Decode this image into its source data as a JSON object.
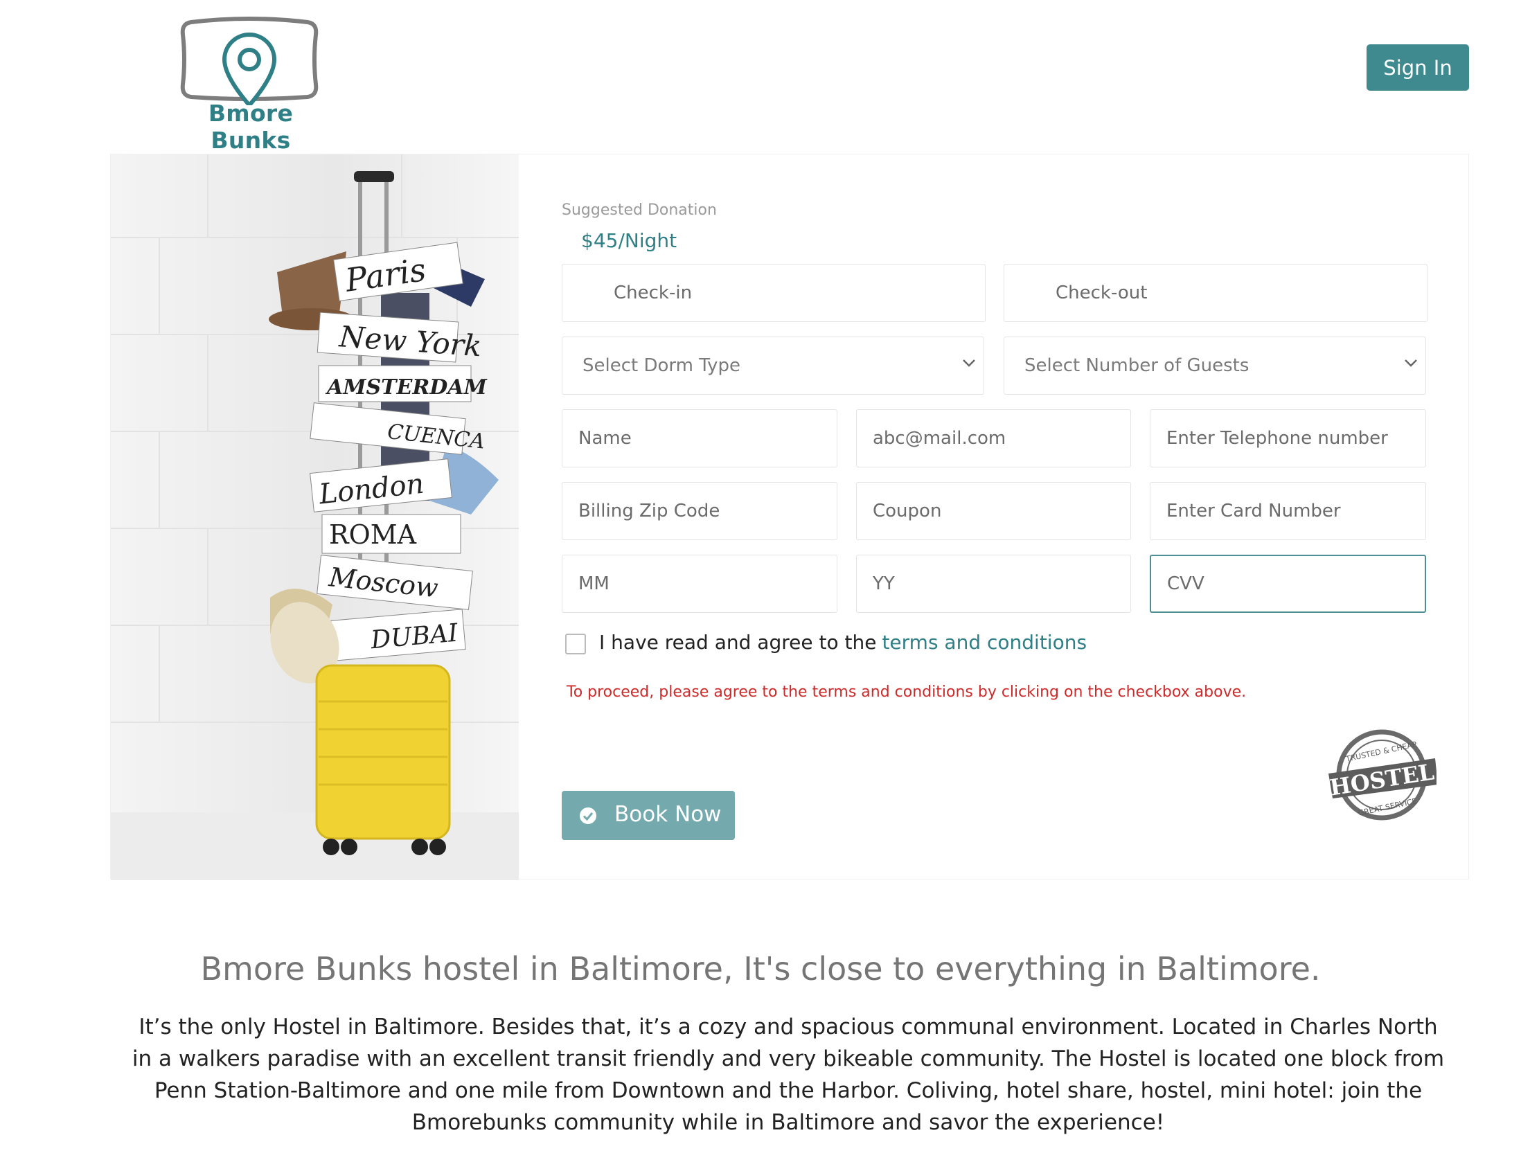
{
  "header": {
    "logo_text": "Bmore Bunks",
    "signin_label": "Sign In"
  },
  "booking": {
    "donation_label": "Suggested Donation",
    "donation_value": "$45/Night",
    "checkin_placeholder": "Check-in",
    "checkout_placeholder": "Check-out",
    "dorm_placeholder": "Select Dorm Type",
    "guests_placeholder": "Select Number of Guests",
    "name_placeholder": "Name",
    "email_placeholder": "abc@mail.com",
    "phone_placeholder": "Enter Telephone number",
    "zip_placeholder": "Billing Zip Code",
    "coupon_placeholder": "Coupon",
    "card_placeholder": "Enter Card Number",
    "mm_placeholder": "MM",
    "yy_placeholder": "YY",
    "cvv_placeholder": "CVV",
    "agree_text": "I have read and agree to the",
    "terms_link": "terms and conditions",
    "error_text": "To proceed, please agree to the terms and conditions by clicking on the checkbox above.",
    "book_label": "Book Now"
  },
  "badge": {
    "title": "HOSTEL",
    "top_text": "TRUSTED & CHEAP",
    "bottom_text": "GREAT SERVICE"
  },
  "photo": {
    "signs": [
      "Paris",
      "New York",
      "AMSTERDAM",
      "CUENCA",
      "London",
      "ROMA",
      "Moscow",
      "DUBAI"
    ]
  },
  "about": {
    "headline": "Bmore Bunks hostel in Baltimore, It's close to everything in Baltimore.",
    "description": "It’s the only Hostel in Baltimore. Besides that, it’s a cozy and spacious communal environment. Located in Charles North in a walkers paradise with an excellent transit friendly and very bikeable community. The Hostel is located one block from Penn Station-Baltimore and one mile from Downtown and the Harbor. Coliving, hotel share, hostel, mini hotel: join the Bmorebunks community while in Baltimore and savor the experience!"
  },
  "colors": {
    "brand": "#2f7f86",
    "button": "#3f8a8f",
    "book_button": "#74a9ad",
    "error": "#cc2b2b"
  }
}
